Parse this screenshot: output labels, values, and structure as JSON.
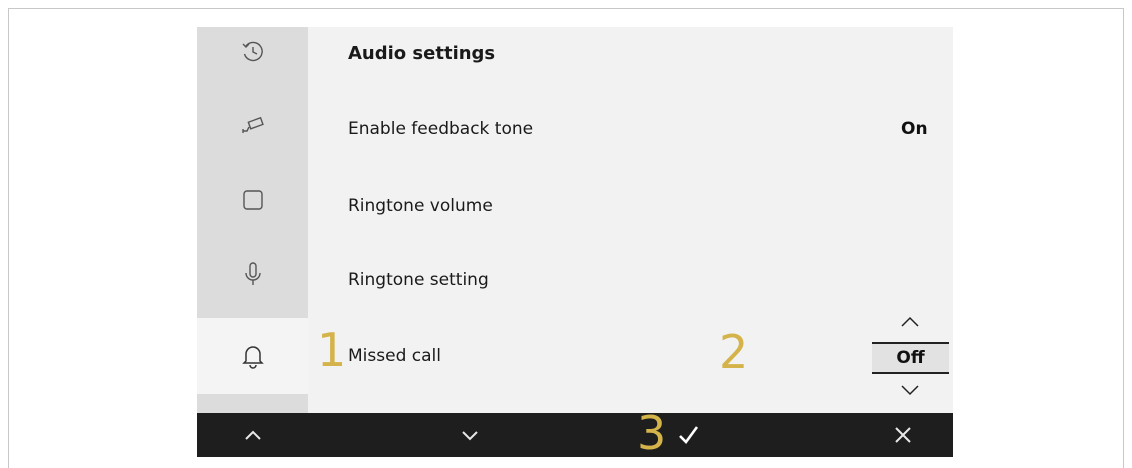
{
  "screen": {
    "title": "Audio settings",
    "settings": [
      {
        "label": "Enable feedback tone",
        "value": "On"
      },
      {
        "label": "Ringtone volume",
        "value": ""
      },
      {
        "label": "Ringtone setting",
        "value": ""
      },
      {
        "label": "Missed call",
        "value": "Off"
      }
    ]
  },
  "sidebar": {
    "items": [
      {
        "icon": "history-icon"
      },
      {
        "icon": "camera-icon"
      },
      {
        "icon": "square-icon"
      },
      {
        "icon": "microphone-icon"
      },
      {
        "icon": "bell-icon",
        "active": true
      }
    ]
  },
  "callouts": [
    "1",
    "2",
    "3"
  ],
  "bottombar": {
    "buttons": [
      "up-icon",
      "down-icon",
      "confirm-check-icon",
      "close-icon"
    ]
  },
  "colors": {
    "callout": "#d4b44a",
    "sidebar": "#dcdcdc",
    "content_bg": "#f2f2f2",
    "bottom_bar": "#1e1e1e"
  }
}
